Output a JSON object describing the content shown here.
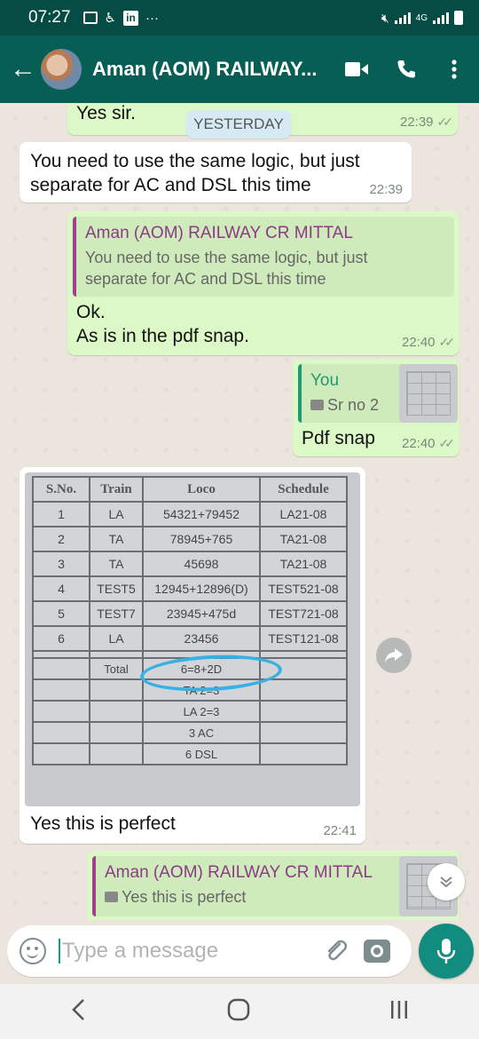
{
  "status_bar": {
    "time": "07:27",
    "icons": [
      "gallery-icon",
      "accessibility-icon",
      "linkedin-icon",
      "more-notifications-icon"
    ],
    "linkedin_label": "in",
    "more": "···",
    "network": "4G"
  },
  "header": {
    "contact_name": "Aman (AOM) RAILWAY...",
    "icons": [
      "back-arrow-icon",
      "video-call-icon",
      "phone-icon",
      "overflow-menu-icon"
    ],
    "back_glyph": "←"
  },
  "chat": {
    "date_separator": "YESTERDAY",
    "messages": [
      {
        "direction": "out",
        "text": "Yes sir.",
        "time": "22:39",
        "ticks": "✓✓"
      },
      {
        "direction": "in",
        "text_line1": "You need to use the same logic, but just",
        "text_line2": "separate for AC and DSL this time",
        "time": "22:39"
      },
      {
        "direction": "out",
        "quote": {
          "author": "Aman (AOM) RAILWAY CR MITTAL",
          "text_line1": "You need to use the same logic, but just",
          "text_line2": "separate for AC and DSL this time"
        },
        "text_line1": "Ok.",
        "text_line2": "As is in the pdf snap.",
        "time": "22:40",
        "ticks": "✓✓"
      },
      {
        "direction": "out",
        "quote": {
          "author": "You",
          "text": "Sr no 2",
          "icon": "camera-small-icon"
        },
        "text": "Pdf snap",
        "time": "22:40",
        "ticks": "✓✓"
      },
      {
        "direction": "in",
        "type": "image",
        "caption": "Yes this is perfect",
        "time": "22:41"
      },
      {
        "direction": "out",
        "quote": {
          "author": "Aman (AOM) RAILWAY CR MITTAL",
          "text": "Yes this is perfect",
          "icon": "camera-small-icon"
        }
      }
    ]
  },
  "photo_table": {
    "headers": [
      "S.No.",
      "Train",
      "Loco",
      "Schedule"
    ],
    "rows": [
      [
        "1",
        "LA",
        "54321+79452",
        "LA21-08"
      ],
      [
        "2",
        "TA",
        "78945+765",
        "TA21-08"
      ],
      [
        "3",
        "TA",
        "45698",
        "TA21-08"
      ],
      [
        "4",
        "TEST5",
        "12945+12896(D)",
        "TEST521-08"
      ],
      [
        "5",
        "TEST7",
        "23945+475d",
        "TEST721-08"
      ],
      [
        "6",
        "LA",
        "23456",
        "TEST121-08"
      ]
    ],
    "total_label": "Total",
    "summary": [
      "6=8+2D",
      "TA 2=3",
      "LA 2=3",
      "3 AC",
      "6 DSL"
    ]
  },
  "composer": {
    "placeholder": "Type a message",
    "icons": [
      "emoji-icon",
      "attach-icon",
      "camera-icon",
      "microphone-icon"
    ]
  },
  "floating": {
    "icons": [
      "forward-icon",
      "scroll-down-icon"
    ]
  },
  "nav_bar": {
    "icons": [
      "recent-apps-icon",
      "home-icon",
      "back-nav-icon"
    ]
  },
  "colors": {
    "header": "#075e54",
    "status_bar": "#054d44",
    "outgoing_bubble": "#dcf8c6",
    "incoming_bubble": "#ffffff",
    "chat_background": "#ece5dd",
    "quote_author": "#8d3a86",
    "you_author": "#1f9a73",
    "highlight_circle": "#39b0e3",
    "fab": "#128c7e"
  }
}
